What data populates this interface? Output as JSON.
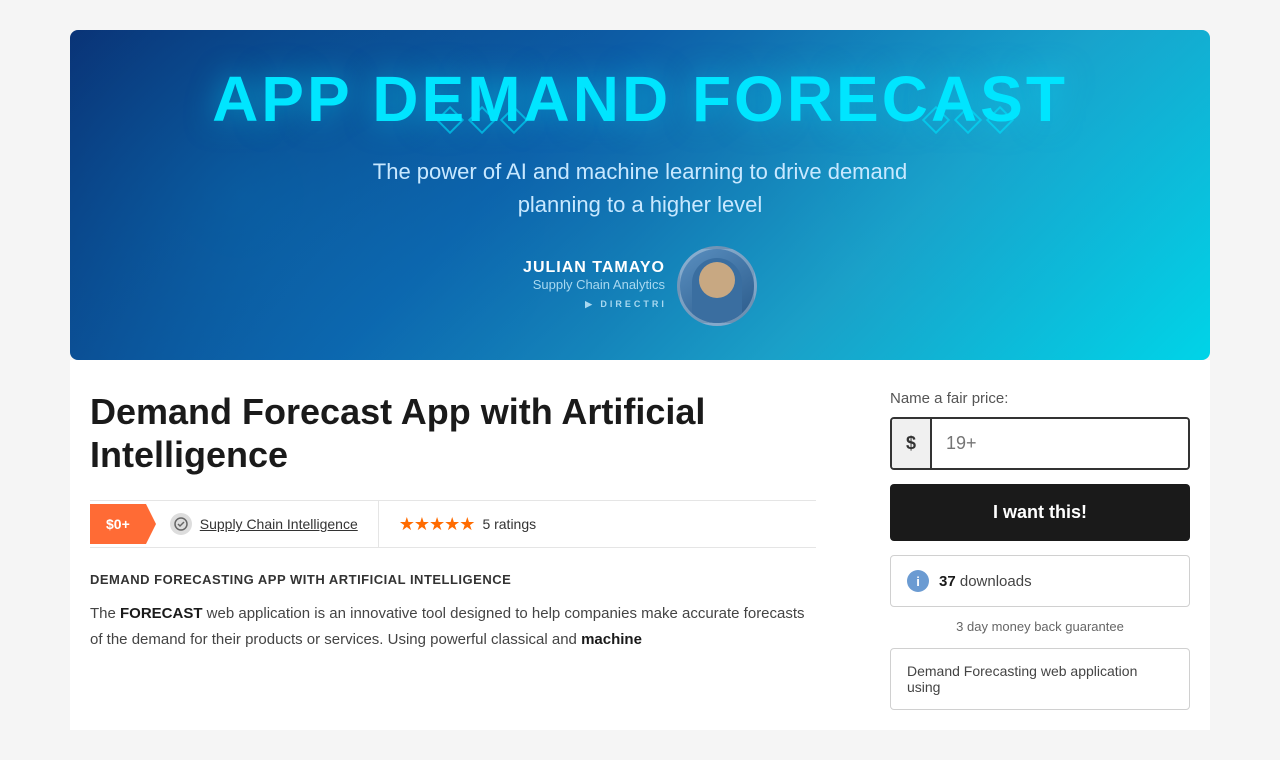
{
  "hero": {
    "title": "APP DEMAND FORECAST",
    "subtitle_line1": "The power of AI and machine learning to drive demand",
    "subtitle_line2": "planning to a higher level",
    "author_name": "JULIAN TAMAYO",
    "author_title": "Supply Chain Analytics",
    "logo_text": "DIRECTRIX"
  },
  "product": {
    "title": "Demand Forecast App with Artificial Intelligence",
    "price_tag": "$0+",
    "category": "Supply Chain Intelligence",
    "ratings_count": "5 ratings",
    "stars": "★★★★★"
  },
  "sidebar": {
    "price_label": "Name a fair price:",
    "currency_symbol": "$",
    "price_placeholder": "19+",
    "buy_button_label": "I want this!",
    "downloads_count": "37",
    "downloads_label": "downloads",
    "guarantee": "3 day money back guarantee",
    "feature_preview": "Demand Forecasting web application using"
  },
  "description": {
    "heading": "DEMAND FORECASTING APP WITH ARTIFICIAL INTELLIGENCE",
    "body_start": "The ",
    "body_bold": "FORECAST",
    "body_rest": " web application is an innovative tool designed to help companies make accurate forecasts of the demand for their products or services. Using powerful classical and ",
    "body_bold2": "machine"
  }
}
